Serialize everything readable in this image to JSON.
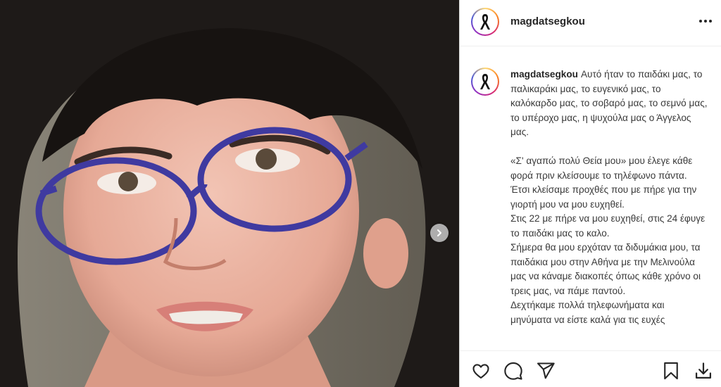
{
  "post": {
    "username": "magdatsegkou",
    "more_icon": "more-horizontal-icon",
    "image_description_icon": "photo",
    "next_icon": "chevron-right-icon"
  },
  "caption": {
    "username": "magdatsegkou",
    "lines": [
      "Αυτό ήταν το παιδάκι μας, το παλικαράκι μας, το ευγενικό μας, το καλόκαρδο μας, το σοβαρό μας, το σεμνό μας, το υπέροχο μας, η ψυχούλα μας ο Άγγελος μας.",
      "«Σ' αγαπώ πολύ Θεία μου» μου έλεγε κάθε φορά πριν κλείσουμε το τηλέφωνο πάντα.",
      "Έτσι κλείσαμε προχθές που με πήρε για την γιορτή μου να μου ευχηθεί.",
      "Στις 22 με πήρε να μου ευχηθεί, στις 24 έφυγε το παιδάκι μας το καλο.",
      "Σήμερα θα μου ερχόταν τα διδυμάκια μου, τα παιδάκια μου στην Αθήνα με την Μελινούλα μας να κάναμε διακοπές όπως κάθε χρόνο οι τρεις μας, να πάμε παντού.",
      "Δεχτήκαμε πολλά τηλεφωνήματα και μηνύματα να είστε καλά για τις ευχές"
    ]
  },
  "actions": {
    "like": "heart-icon",
    "comment": "comment-icon",
    "share": "send-icon",
    "save": "bookmark-icon",
    "download": "download-icon"
  },
  "colors": {
    "text": "#262626",
    "border": "#dbdbdb",
    "story_ring": "#d62976"
  }
}
